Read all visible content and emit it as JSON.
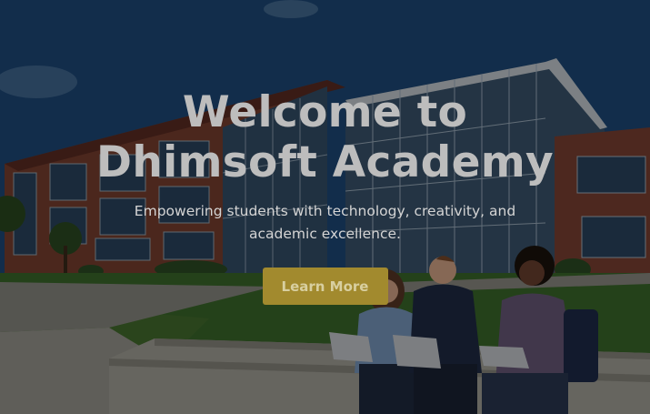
{
  "hero": {
    "title": "Welcome to Dhimsoft Academy",
    "subtitle": "Empowering students with technology, creativity, and academic excellence.",
    "cta_label": "Learn More",
    "background_image": "campus-building-with-students"
  },
  "colors": {
    "overlay": "#000000",
    "title_text": "#bdbdbd",
    "subtitle_text": "#d4d4d4",
    "cta_background": "#a28a2e",
    "cta_text": "#d8cfa0"
  }
}
